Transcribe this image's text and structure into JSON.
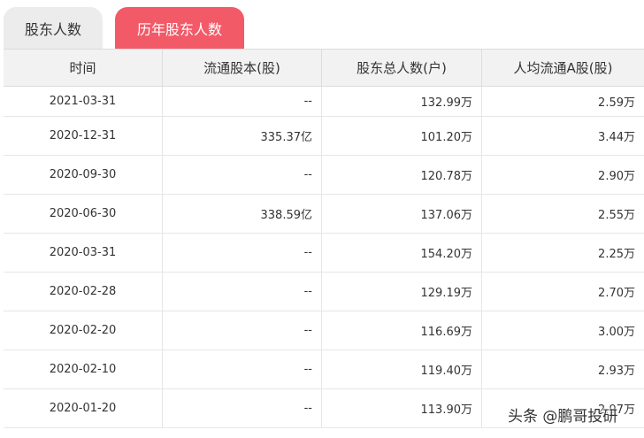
{
  "tabs": [
    {
      "label": "股东人数"
    },
    {
      "label": "历年股东人数"
    }
  ],
  "table": {
    "headers": [
      "时间",
      "流通股本(股)",
      "股东总人数(户)",
      "人均流通A股(股)"
    ],
    "rows": [
      [
        "2021-03-31",
        "--",
        "132.99万",
        "2.59万"
      ],
      [
        "2020-12-31",
        "335.37亿",
        "101.20万",
        "3.44万"
      ],
      [
        "2020-09-30",
        "--",
        "120.78万",
        "2.90万"
      ],
      [
        "2020-06-30",
        "338.59亿",
        "137.06万",
        "2.55万"
      ],
      [
        "2020-03-31",
        "--",
        "154.20万",
        "2.25万"
      ],
      [
        "2020-02-28",
        "--",
        "129.19万",
        "2.70万"
      ],
      [
        "2020-02-20",
        "--",
        "116.69万",
        "3.00万"
      ],
      [
        "2020-02-10",
        "--",
        "119.40万",
        "2.93万"
      ],
      [
        "2020-01-20",
        "--",
        "113.90万",
        "2.97万"
      ]
    ]
  },
  "watermark": "头条 @鹏哥投研",
  "colors": {
    "active_tab": "#f25a68",
    "inactive_tab": "#ececec",
    "header_bg": "#f2f2f2"
  }
}
